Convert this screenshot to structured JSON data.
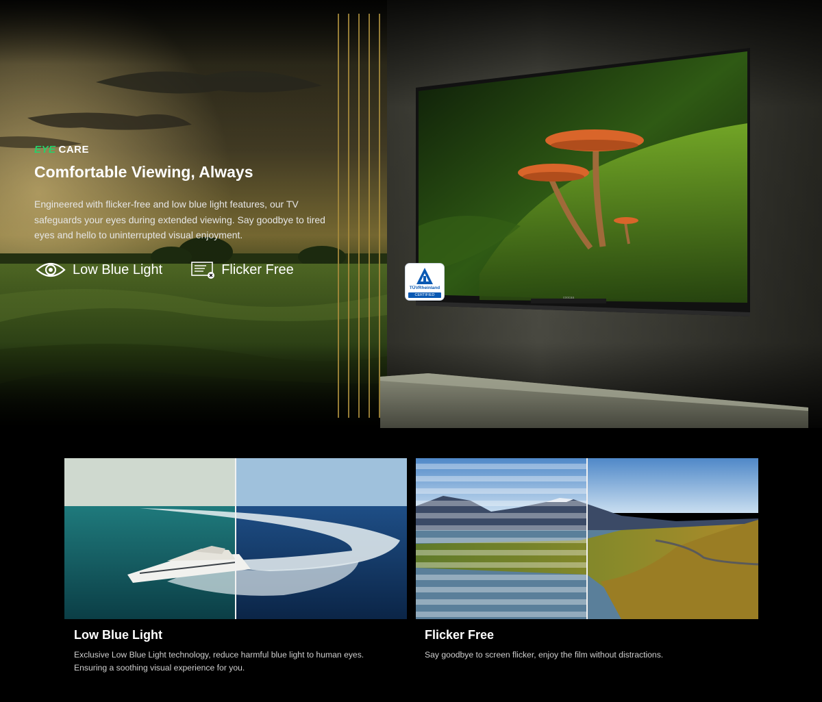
{
  "hero": {
    "badge_eye": "EYE",
    "badge_care": "CARE",
    "title": "Comfortable Viewing, Always",
    "description": "Engineered with flicker-free and low blue light features, our TV safeguards your eyes during extended viewing. Say goodbye to tired eyes and hello to uninterrupted visual enjoyment.",
    "features": [
      {
        "label": "Low Blue Light",
        "icon": "eye-icon"
      },
      {
        "label": "Flicker Free",
        "icon": "screen-no-flicker-icon"
      }
    ],
    "certification": {
      "brand": "TÜVRheinland",
      "status": "CERTIFIED",
      "icon": "tuv-triangle-icon"
    },
    "tv_brand": "coocaa"
  },
  "cards": [
    {
      "title": "Low Blue Light",
      "description": "Exclusive Low Blue Light technology, reduce harmful blue light to human eyes.  Ensuring a soothing visual experience for you."
    },
    {
      "title": "Flicker Free",
      "description": "Say goodbye to screen flicker, enjoy the film without distractions."
    }
  ],
  "colors": {
    "background": "#000000",
    "eye_accent": "#27d06a",
    "tuv_blue": "#0a59b3",
    "mushroom_orange": "#d9652a"
  }
}
